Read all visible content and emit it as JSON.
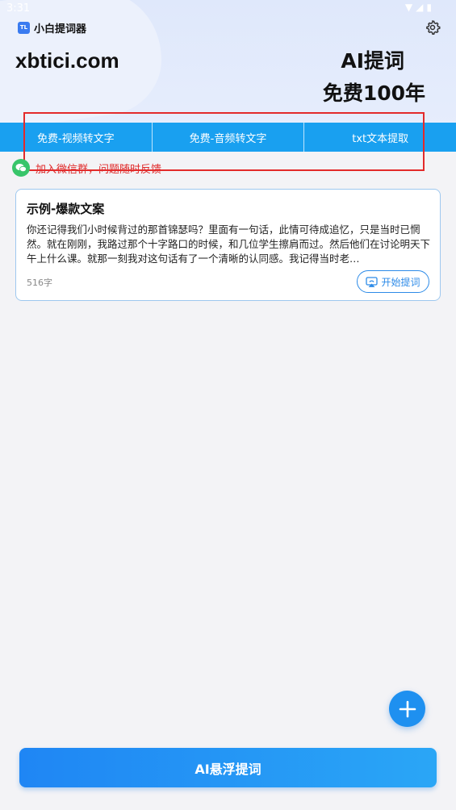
{
  "status_bar": {
    "time": "3:31",
    "icons": [
      "wifi-icon",
      "signal-icon",
      "battery-icon"
    ]
  },
  "app": {
    "logo_text": "TL",
    "name": "小白提词器"
  },
  "header": {
    "site": "xbtici.com",
    "slogan_line1": "AI提词",
    "slogan_line2": "免费100年"
  },
  "tabs": [
    {
      "label": "免费-视频转文字"
    },
    {
      "label": "免费-音频转文字"
    },
    {
      "label": "txt文本提取"
    }
  ],
  "wechat": {
    "text": "加入微信群，问题随时反馈"
  },
  "card": {
    "title": "示例-爆款文案",
    "body": "你还记得我们小时候背过的那首锦瑟吗？里面有一句话，此情可待成追忆，只是当时已惘然。就在刚刚，我路过那个十字路口的时候，和几位学生擦肩而过。然后他们在讨论明天下午上什么课。就那一刻我对这句话有了一个清晰的认同感。我记得当时老…",
    "count": "516字",
    "start_label": "开始提词"
  },
  "main_button": {
    "label": "AI悬浮提词"
  },
  "colors": {
    "accent": "#19a0f0",
    "highlight": "#e32a2a",
    "wechat": "#38c56a"
  }
}
